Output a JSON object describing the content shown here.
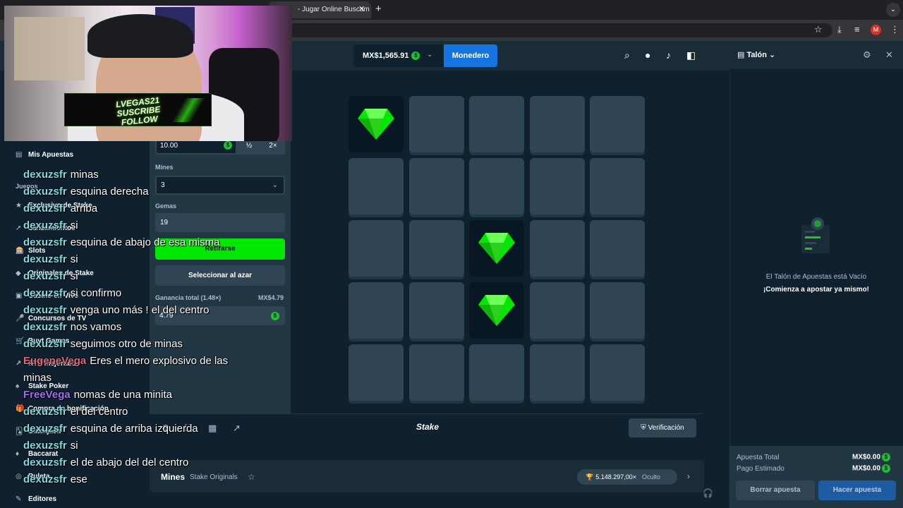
{
  "browser": {
    "tab_title": "- Jugar Online Buscam",
    "tab_close": "✕",
    "new_tab": "+",
    "avatar_letter": "M"
  },
  "header": {
    "balance": "MX$1,565.91",
    "currency_symbol": "$",
    "wallet_label": "Monedero"
  },
  "sidebar": {
    "my_bets": "Mis Apuestas",
    "section_label": "Juegos",
    "items": [
      {
        "label": "Exclusivo de Stake",
        "icon": "star-icon"
      },
      {
        "label": "Lanzamientos",
        "icon": "rocket-icon"
      },
      {
        "label": "Slots",
        "icon": "slots-icon"
      },
      {
        "label": "Originales de Stake",
        "icon": "originals-icon"
      },
      {
        "label": "Casino en Vivo",
        "icon": "live-casino-icon"
      },
      {
        "label": "Concursos de TV",
        "icon": "microphone-icon"
      },
      {
        "label": "Buyt Games",
        "icon": "cart-icon"
      },
      {
        "label": "RTP mejorado",
        "icon": "trend-icon"
      },
      {
        "label": "Stake Poker",
        "icon": "poker-icon"
      },
      {
        "label": "Compra de bonificación",
        "icon": "gift-icon"
      },
      {
        "label": "Blackjack",
        "icon": "cards-icon"
      },
      {
        "label": "Baccarat",
        "icon": "baccarat-icon"
      },
      {
        "label": "Ruleta",
        "icon": "roulette-icon"
      },
      {
        "label": "Editores",
        "icon": "publisher-icon"
      }
    ]
  },
  "bet_panel": {
    "bet_amount": "10.00",
    "half_label": "½",
    "double_label": "2×",
    "mines_label": "Mines",
    "mines_value": "3",
    "gems_label": "Gemas",
    "gems_value": "19",
    "cashout_label": "Retirarse",
    "random_label": "Seleccionar al azar",
    "profit_label": "Ganancia total (1.48×)",
    "profit_amount": "MX$4.79",
    "profit_value": "4.79"
  },
  "board": {
    "columns": 5,
    "revealed_gems": [
      [
        0,
        0
      ],
      [
        2,
        2
      ],
      [
        3,
        2
      ]
    ]
  },
  "footer": {
    "logo": "Stake",
    "verify_label": "Verificación"
  },
  "info_bar": {
    "game_name": "Mines",
    "game_sub": "Stake Originals",
    "record_value": "5.148.297,00×",
    "record_hidden": "Oculto"
  },
  "betslip": {
    "title": "Talón",
    "empty_title": "El Talón de Apuestas está Vacío",
    "empty_cta": "¡Comienza a apostar ya mismo!",
    "total_bet_label": "Apuesta Total",
    "total_bet_value": "MX$0.00",
    "payout_label": "Pago Estimado",
    "payout_value": "MX$0.00",
    "clear_label": "Borrar apuesta",
    "place_label": "Hacer apuesta"
  },
  "webcam": {
    "banner_line1": "LVEGAS21",
    "banner_line2": "SUSCRIBE",
    "banner_line3": "FOLLOW"
  },
  "chat": [
    {
      "user": "dexuzsfr",
      "color": "#7fd9e0",
      "text": "minas"
    },
    {
      "user": "dexuzsfr",
      "color": "#7fd9e0",
      "text": "esquina derecha"
    },
    {
      "user": "dexuzsfr",
      "color": "#7fd9e0",
      "text": "arriba"
    },
    {
      "user": "dexuzsfr",
      "color": "#7fd9e0",
      "text": "si"
    },
    {
      "user": "dexuzsfr",
      "color": "#7fd9e0",
      "text": "esquina de abajo de esa misma"
    },
    {
      "user": "dexuzsfr",
      "color": "#7fd9e0",
      "text": "si"
    },
    {
      "user": "dexuzsfr",
      "color": "#7fd9e0",
      "text": "si"
    },
    {
      "user": "dexuzsfr",
      "color": "#7fd9e0",
      "text": "si confirmo"
    },
    {
      "user": "dexuzsfr",
      "color": "#7fd9e0",
      "text": "venga uno más ! el del centro"
    },
    {
      "user": "dexuzsfr",
      "color": "#7fd9e0",
      "text": "nos vamos"
    },
    {
      "user": "dexuzsfr",
      "color": "#7fd9e0",
      "text": "seguimos otro de minas"
    },
    {
      "user": "EugeneVega",
      "color": "#e0657a",
      "text": "Eres el mero explosivo de las minas"
    },
    {
      "user": "FreeVega",
      "color": "#a46bf0",
      "text": "nomas de una minita"
    },
    {
      "user": "dexuzsfr",
      "color": "#7fd9e0",
      "text": "el del centro"
    },
    {
      "user": "dexuzsfr",
      "color": "#7fd9e0",
      "text": "esquina de arriba izquierda"
    },
    {
      "user": "dexuzsfr",
      "color": "#7fd9e0",
      "text": "si"
    },
    {
      "user": "dexuzsfr",
      "color": "#7fd9e0",
      "text": "el de abajo del del centro"
    },
    {
      "user": "dexuzsfr",
      "color": "#7fd9e0",
      "text": "ese"
    }
  ]
}
